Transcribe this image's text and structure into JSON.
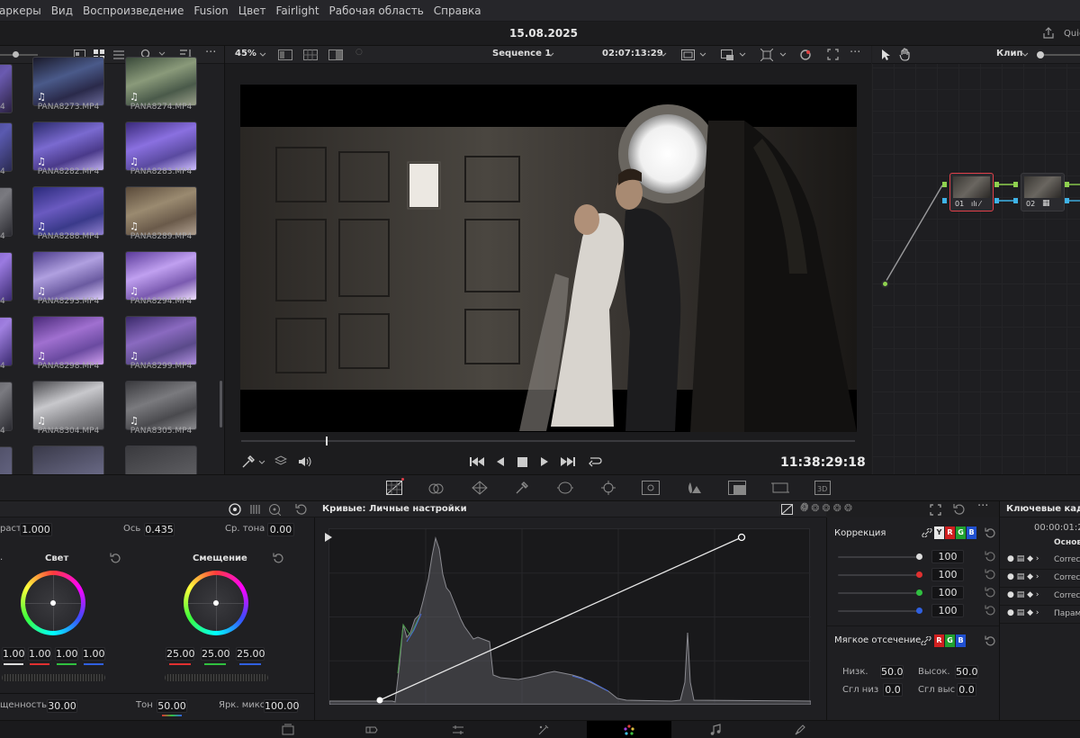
{
  "menu": [
    "аркеры",
    "Вид",
    "Воспроизведение",
    "Fusion",
    "Цвет",
    "Fairlight",
    "Рабочая область",
    "Справка"
  ],
  "title_bar": {
    "project_date": "15.08.2025",
    "quick_label": "Quic"
  },
  "media_pool": {
    "clips": [
      {
        "name": "PANA8273.MP4",
        "audio": true
      },
      {
        "name": "PANA8274.MP4",
        "audio": true
      },
      {
        "name": "PANA8282.MP4",
        "audio": true
      },
      {
        "name": "PANA8283.MP4",
        "audio": true
      },
      {
        "name": "PANA8288.MP4",
        "audio": true
      },
      {
        "name": "PANA8289.MP4",
        "audio": true
      },
      {
        "name": "PANA8293.MP4",
        "audio": true
      },
      {
        "name": "PANA8294.MP4",
        "audio": true
      },
      {
        "name": "PANA8298.MP4",
        "audio": true
      },
      {
        "name": "PANA8299.MP4",
        "audio": true
      },
      {
        "name": "PANA8304.MP4",
        "audio": true
      },
      {
        "name": "PANA8305.MP4",
        "audio": true
      }
    ],
    "left_column_labels": [
      "4",
      "4",
      "4",
      "4",
      "4",
      "4"
    ]
  },
  "viewer": {
    "zoom": "45%",
    "sequence": "Sequence 1",
    "source_timecode": "02:07:13:29",
    "timecode": "11:38:29:18",
    "scrub_position": 0.14
  },
  "nodes": {
    "mode": "Клип",
    "node1_label": "01",
    "node2_label": "02"
  },
  "wheels": {
    "contrast_label": "раст",
    "contrast": "1.000",
    "axis_label": "Ось",
    "axis": "0.435",
    "midtone_label": "Ср. тона",
    "midtone": "0.00",
    "gain": {
      "title": "Свет",
      "values": [
        "1.00",
        "1.00",
        "1.00",
        "1.00"
      ]
    },
    "offset": {
      "title": "Смещение",
      "values": [
        "25.00",
        "25.00",
        "25.00"
      ]
    },
    "saturation_label": "щенность",
    "saturation": "30.00",
    "tone_label": "Тон",
    "tone": "50.00",
    "lum_mix_label": "Ярк. микс",
    "lum_mix": "100.00"
  },
  "curves": {
    "title": "Кривые: Личные настройки"
  },
  "correction": {
    "title": "Коррекция",
    "channels": [
      "Y",
      "R",
      "G",
      "B"
    ],
    "values": [
      "100",
      "100",
      "100",
      "100"
    ],
    "soft_clip_title": "Мягкое отсечение",
    "soft_channels": [
      "R",
      "G",
      "B"
    ],
    "low_label": "Низк.",
    "low": "50.0",
    "high_label": "Высок.",
    "high": "50.0",
    "low_soft_label": "Сгл низ",
    "low_soft": "0.0",
    "high_soft_label": "Сгл выс",
    "high_soft": "0.0"
  },
  "keyframes": {
    "title": "Ключевые кадр",
    "timecode": "00:00:01:2",
    "header": "Основ",
    "rows": [
      "Correc",
      "Correc",
      "Correc",
      "Парам"
    ]
  },
  "colors": {
    "accent": "#e0404a",
    "node_green": "#8fd14f",
    "node_blue": "#3fb3e8",
    "page_active": "#000000"
  }
}
